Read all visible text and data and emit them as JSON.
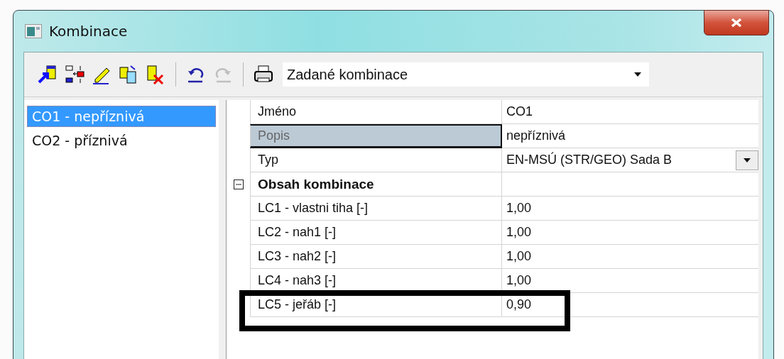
{
  "window": {
    "title": "Kombinace"
  },
  "toolbar": {
    "groups": [
      [
        {
          "kind": "insert",
          "disabled": false
        },
        {
          "kind": "swap",
          "disabled": false
        },
        {
          "kind": "edit",
          "disabled": false
        },
        {
          "kind": "copy",
          "disabled": false
        },
        {
          "kind": "delete",
          "disabled": false
        }
      ],
      [
        {
          "kind": "undo",
          "disabled": false
        },
        {
          "kind": "redo",
          "disabled": true
        }
      ],
      [
        {
          "kind": "print",
          "disabled": false
        }
      ]
    ],
    "filter": {
      "value": "Zadané kombinace"
    }
  },
  "combinations": [
    {
      "label": "CO1 - nepříznivá",
      "selected": true
    },
    {
      "label": "CO2 - příznivá",
      "selected": false
    }
  ],
  "properties": [
    {
      "kind": "text",
      "name": "Jméno",
      "value": "CO1",
      "selected": false
    },
    {
      "kind": "text",
      "name": "Popis",
      "value": "nepříznivá",
      "selected": true
    },
    {
      "kind": "dropdown",
      "name": "Typ",
      "value": "EN-MSÚ (STR/GEO) Sada B",
      "selected": false
    },
    {
      "kind": "group",
      "name": "Obsah kombinace",
      "expanded": true,
      "selected": false,
      "children": [
        {
          "kind": "text",
          "name": "LC1 - vlastni tiha [-]",
          "value": "1,00",
          "selected": false
        },
        {
          "kind": "text",
          "name": "LC2 - nah1 [-]",
          "value": "1,00",
          "selected": false
        },
        {
          "kind": "text",
          "name": "LC3 - nah2 [-]",
          "value": "1,00",
          "selected": false
        },
        {
          "kind": "text",
          "name": "LC4 - nah3 [-]",
          "value": "1,00",
          "selected": false
        },
        {
          "kind": "text",
          "name": "LC5 - jeřáb [-]",
          "value": "0,90",
          "selected": false
        }
      ]
    }
  ],
  "highlight": {
    "kind": "frame"
  }
}
